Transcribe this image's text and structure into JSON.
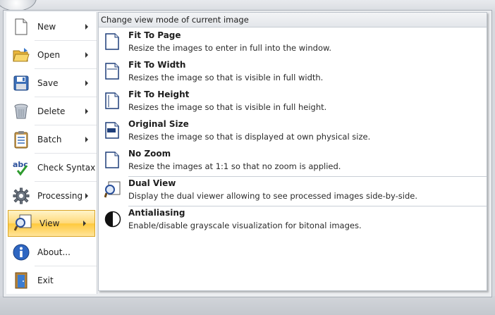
{
  "left_menu": {
    "items": [
      {
        "label": "New",
        "icon": "new-document-icon",
        "submenu": true
      },
      {
        "label": "Open",
        "icon": "folder-open-icon",
        "submenu": true
      },
      {
        "label": "Save",
        "icon": "floppy-disk-icon",
        "submenu": true
      },
      {
        "label": "Delete",
        "icon": "trash-can-icon",
        "submenu": true
      },
      {
        "label": "Batch",
        "icon": "clipboard-list-icon",
        "submenu": true
      },
      {
        "label": "Check Syntax",
        "icon": "abc-check-icon",
        "submenu": false
      },
      {
        "label": "Processing",
        "icon": "gear-icon",
        "submenu": true
      },
      {
        "label": "View",
        "icon": "magnifier-icon",
        "submenu": true,
        "selected": true
      },
      {
        "label": "About...",
        "icon": "info-icon",
        "submenu": false
      },
      {
        "label": "Exit",
        "icon": "exit-door-icon",
        "submenu": false
      }
    ]
  },
  "panel": {
    "header": "Change view mode of current image",
    "options": [
      {
        "title": "Fit To Page",
        "desc": "Resize the images to enter in full into the window.",
        "icon": "fit-page-icon"
      },
      {
        "title": "Fit To Width",
        "desc": "Resizes the image so that is visible in full width.",
        "icon": "fit-width-icon"
      },
      {
        "title": "Fit To Height",
        "desc": "Resizes the image so that is visible in full height.",
        "icon": "fit-height-icon"
      },
      {
        "title": "Original Size",
        "desc": "Resizes the image so that is displayed at own physical size.",
        "icon": "dpi-page-icon"
      },
      {
        "title": "No Zoom",
        "desc": "Resize the images at 1:1 so that no zoom is applied.",
        "icon": "no-zoom-page-icon"
      },
      {
        "title": "Dual View",
        "desc": "Display the dual viewer allowing to see processed images side-by-side.",
        "icon": "dual-view-magnifier-icon"
      },
      {
        "title": "Antialiasing",
        "desc": "Enable/disable grayscale visualization for bitonal images.",
        "icon": "half-circle-contrast-icon"
      }
    ]
  },
  "colors": {
    "selected_gradient_mid": "#ffd978",
    "selected_border": "#d9a528",
    "panel_header_bg": "#e3e6ea"
  }
}
